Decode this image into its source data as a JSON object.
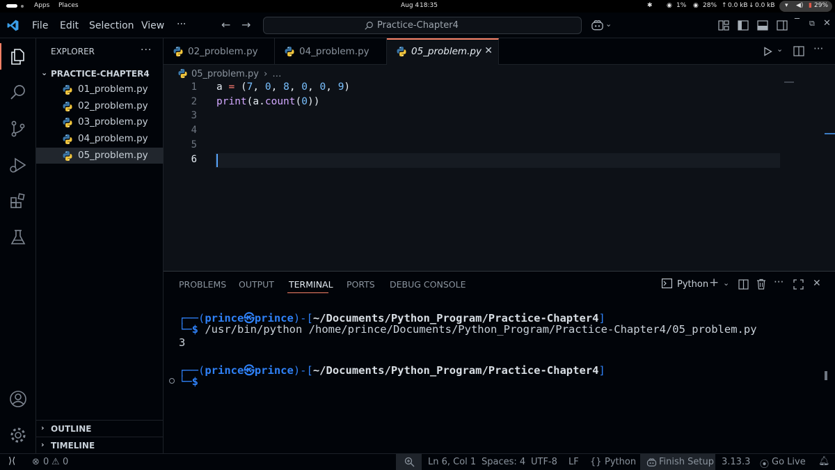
{
  "system_bar": {
    "apps": "Apps",
    "places": "Places",
    "date": "Aug 4",
    "time": "18:35",
    "cpu": "1%",
    "memory": "28%",
    "net_up": "0.0 kB",
    "net_down": "0.0 kB",
    "battery": "29%"
  },
  "titlebar": {
    "menu": [
      "File",
      "Edit",
      "Selection",
      "View"
    ],
    "more": "···",
    "search_text": "Practice-Chapter4"
  },
  "explorer": {
    "title": "EXPLORER",
    "more": "···",
    "folder": "PRACTICE-CHAPTER4",
    "files": [
      "01_problem.py",
      "02_problem.py",
      "03_problem.py",
      "04_problem.py",
      "05_problem.py"
    ],
    "selected_index": 4,
    "outline": "OUTLINE",
    "timeline": "TIMELINE"
  },
  "tabs": [
    {
      "label": "02_problem.py",
      "active": false
    },
    {
      "label": "04_problem.py",
      "active": false
    },
    {
      "label": "05_problem.py",
      "active": true
    }
  ],
  "breadcrumb": {
    "file": "05_problem.py",
    "rest": "…"
  },
  "editor": {
    "line_numbers": [
      "1",
      "2",
      "3",
      "4",
      "5",
      "6"
    ],
    "current_line": 6,
    "lines": [
      "a = (7, 0, 8, 0, 0, 9)",
      "print(a.count(0))",
      "",
      "",
      "",
      ""
    ]
  },
  "panel": {
    "tabs": [
      "PROBLEMS",
      "OUTPUT",
      "TERMINAL",
      "PORTS",
      "DEBUG CONSOLE"
    ],
    "active_tab": "TERMINAL",
    "terminal_profile": "Python",
    "terminal": {
      "user": "prince",
      "host": "prince",
      "cwd": "~/Documents/Python_Program/Practice-Chapter4",
      "command": "/usr/bin/python /home/prince/Documents/Python_Program/Practice-Chapter4/05_problem.py",
      "output": "3"
    }
  },
  "statusbar": {
    "errors": "0",
    "warnings": "0",
    "position": "Ln 6, Col 1",
    "spaces": "Spaces: 4",
    "encoding": "UTF-8",
    "eol": "LF",
    "language": "Python",
    "finish_setup": "Finish Setup",
    "python_version": "3.13.3",
    "go_live": "Go Live"
  },
  "colors": {
    "accent": "#f78166",
    "editor_bg": "#0d1117",
    "chrome_bg": "#010409",
    "prompt_blue": "#2f81f7"
  }
}
